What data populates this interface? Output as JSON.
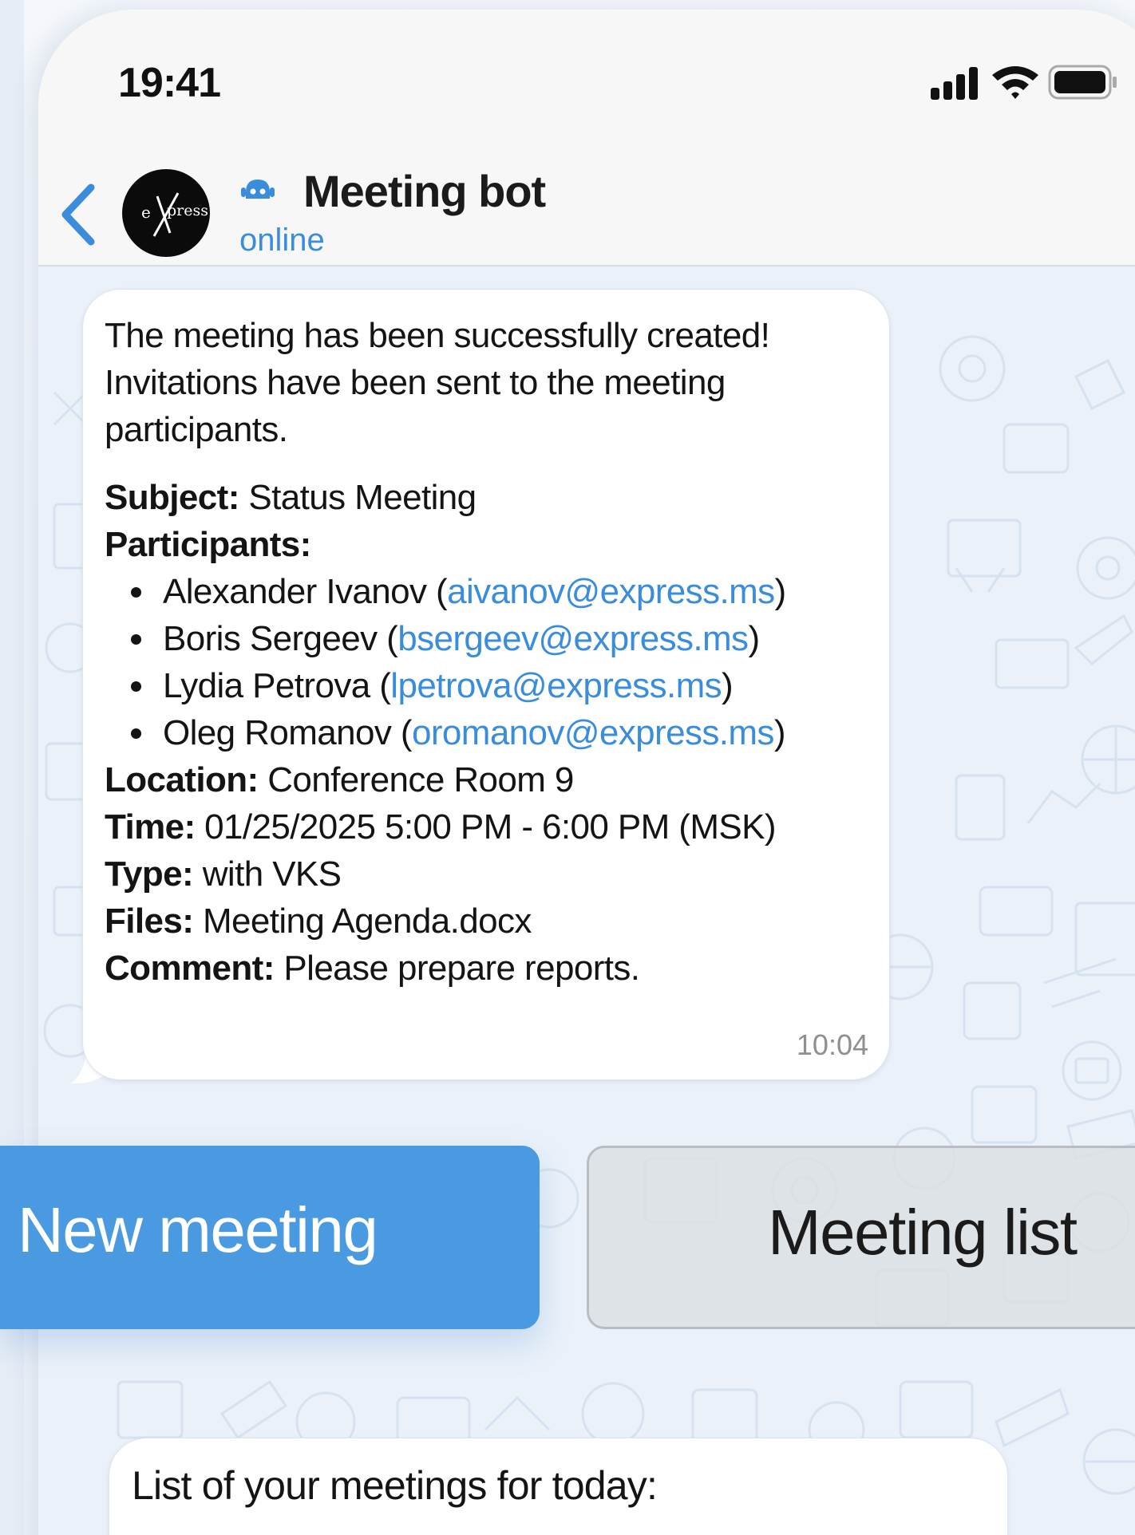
{
  "status_bar": {
    "time": "19:41",
    "icons": [
      "cellular-signal-icon",
      "wifi-icon",
      "battery-icon"
    ]
  },
  "header": {
    "back_icon": "chevron-left-icon",
    "avatar_text": "eXpress",
    "bot_icon": "bot-icon",
    "title": "Meeting bot",
    "status": "online"
  },
  "message": {
    "intro": "The meeting has been successfully created! Invitations have been sent to the meeting participants.",
    "subject_label": "Subject:",
    "subject_value": " Status Meeting",
    "participants_label": "Participants:",
    "participants": [
      {
        "name": "Alexander Ivanov (",
        "email": "aivanov@express.ms",
        "close": ")"
      },
      {
        "name": "Boris Sergeev (",
        "email": "bsergeev@express.ms",
        "close": ")"
      },
      {
        "name": "Lydia Petrova (",
        "email": "lpetrova@express.ms",
        "close": ")"
      },
      {
        "name": "Oleg Romanov (",
        "email": "oromanov@express.ms",
        "close": ")"
      }
    ],
    "location_label": "Location:",
    "location_value": " Conference Room 9",
    "time_label": "Time:",
    "time_value": " 01/25/2025 5:00 PM - 6:00 PM (MSK)",
    "type_label": "Type:",
    "type_value": " with VKS",
    "files_label": "Files:",
    "files_value": " Meeting Agenda.docx",
    "comment_label": "Comment:",
    "comment_value": " Please prepare reports.",
    "timestamp": "10:04"
  },
  "buttons": {
    "new_meeting": "New meeting",
    "meeting_list": "Meeting list"
  },
  "message2": {
    "text": "List of your meetings for today:"
  },
  "colors": {
    "accent": "#4a9ae2",
    "link": "#3a8ddb",
    "header_bg": "#f7f7f7",
    "wallpaper_bg": "#eaf1f9"
  }
}
